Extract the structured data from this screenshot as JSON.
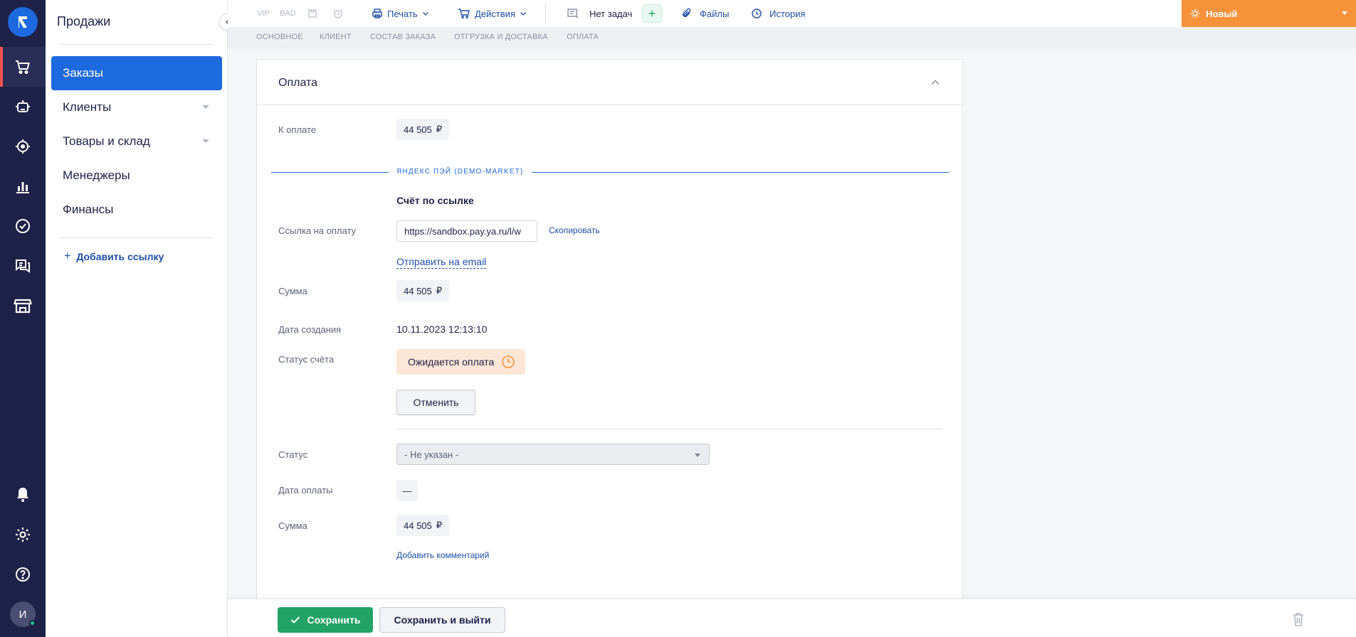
{
  "rail": {
    "avatar_letter": "И",
    "icons": [
      "logo-icon",
      "cart-icon",
      "robot-icon",
      "target-icon",
      "chart-icon",
      "check-circle-icon",
      "chat-icon",
      "store-icon",
      "bell-icon",
      "gear-icon",
      "help-icon"
    ]
  },
  "sidebar": {
    "title": "Продажи",
    "items": [
      {
        "label": "Заказы",
        "active": true
      },
      {
        "label": "Клиенты",
        "has_caret": true
      },
      {
        "label": "Товары и склад",
        "has_caret": true
      },
      {
        "label": "Менеджеры"
      },
      {
        "label": "Финансы"
      }
    ],
    "add_link": "Добавить ссылку"
  },
  "toolbar": {
    "vip": "VIP",
    "bad": "BAD",
    "print": "Печать",
    "actions": "Действия",
    "tasks": "Нет задач",
    "files": "Файлы",
    "history": "История",
    "status": "Новый"
  },
  "tabs": [
    "ОСНОВНОЕ",
    "КЛИЕНТ",
    "СОСТАВ ЗАКАЗА",
    "ОТГРУЗКА И ДОСТАВКА",
    "ОПЛАТА"
  ],
  "payment": {
    "title": "Оплата",
    "to_pay_label": "К оплате",
    "to_pay_value": "44 505",
    "currency": "₽",
    "section_title": "ЯНДЕКС ПЭЙ (DEMO-MARKET)",
    "invoice_heading": "Счёт по ссылке",
    "link_label": "Ссылка на оплату",
    "link_value": "https://sandbox.pay.ya.ru/l/w",
    "copy": "Скопировать",
    "send_email": "Отправить на email",
    "sum_label": "Сумма",
    "sum_value": "44 505",
    "created_label": "Дата создания",
    "created_value": "10.11.2023 12:13:10",
    "invoice_status_label": "Статус счёта",
    "invoice_status_value": "Ожидается оплата",
    "cancel": "Отменить",
    "status_label": "Статус",
    "status_value": "- Не указан -",
    "pay_date_label": "Дата оплаты",
    "pay_date_value": "—",
    "sum2_label": "Сумма",
    "sum2_value": "44 505",
    "add_comment": "Добавить комментарий"
  },
  "footer": {
    "save": "Сохранить",
    "save_exit": "Сохранить и выйти"
  },
  "colors": {
    "rail": "#1e2248",
    "primary": "#1d69e0",
    "status_orange": "#f6923a",
    "save_green": "#21a366",
    "badge_bg": "#fce6d6"
  }
}
